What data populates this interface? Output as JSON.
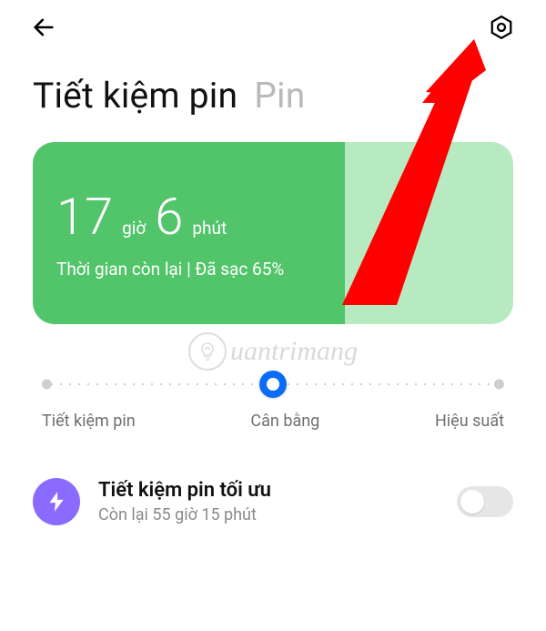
{
  "header": {
    "title_active": "Tiết kiệm pin",
    "title_inactive": "Pin"
  },
  "battery_card": {
    "hours": "17",
    "hours_unit": "giờ",
    "minutes": "6",
    "minutes_unit": "phút",
    "status": "Thời gian còn lại | Đã sạc 65%",
    "charge_percent": 65
  },
  "slider": {
    "left_label": "Tiết kiệm pin",
    "mid_label": "Cân bằng",
    "right_label": "Hiệu suất",
    "selected_index": 1
  },
  "ultra_saver": {
    "title": "Tiết kiệm pin tối ưu",
    "subtitle": "Còn lại 55 giờ 15 phút",
    "enabled": false
  },
  "watermark": {
    "text": "uantrimang"
  },
  "icons": {
    "back": "back-icon",
    "gear": "gear-icon",
    "bolt": "bolt-icon"
  },
  "colors": {
    "card_green": "#52c46a",
    "card_green_light": "#b8eac2",
    "accent_blue": "#0b6df7",
    "bolt_purple": "#8a6bff",
    "annotation_red": "#ff0000"
  }
}
